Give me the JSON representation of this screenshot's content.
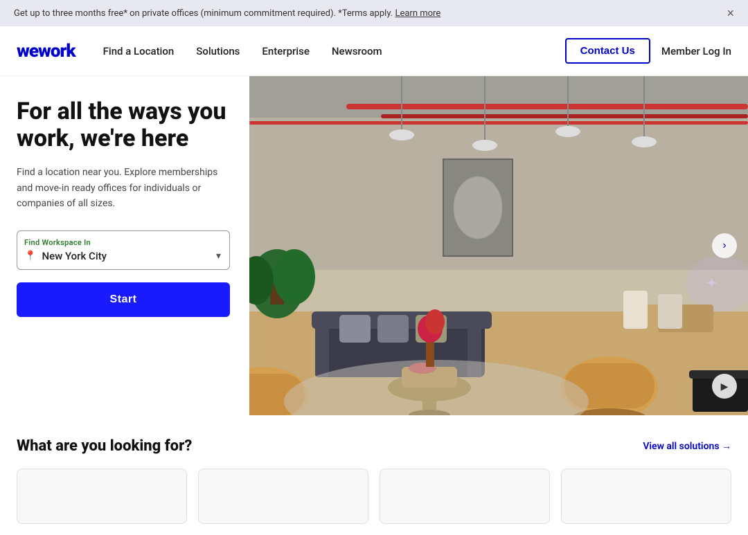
{
  "announcement": {
    "text": "Get up to three months free* on private offices (minimum commitment required). *Terms apply.",
    "link_text": "Learn more",
    "close_label": "×"
  },
  "header": {
    "logo": "wework",
    "nav_items": [
      {
        "label": "Find a Location",
        "id": "find-location"
      },
      {
        "label": "Solutions",
        "id": "solutions"
      },
      {
        "label": "Enterprise",
        "id": "enterprise"
      },
      {
        "label": "Newsroom",
        "id": "newsroom"
      }
    ],
    "contact_btn": "Contact Us",
    "member_login": "Member Log In"
  },
  "hero": {
    "title": "For all the ways you work, we're here",
    "subtitle_part1": "Find a location near you. Explore memberships and move-in ready offices for individuals or companies of all sizes.",
    "workspace_label": "Find Workspace In",
    "workspace_value": "New York City",
    "start_btn": "Start",
    "arrow_left": "‹",
    "arrow_right": "›",
    "play_icon": "▶"
  },
  "bottom": {
    "section_title": "What are you looking for?",
    "view_all_label": "View all solutions →"
  }
}
